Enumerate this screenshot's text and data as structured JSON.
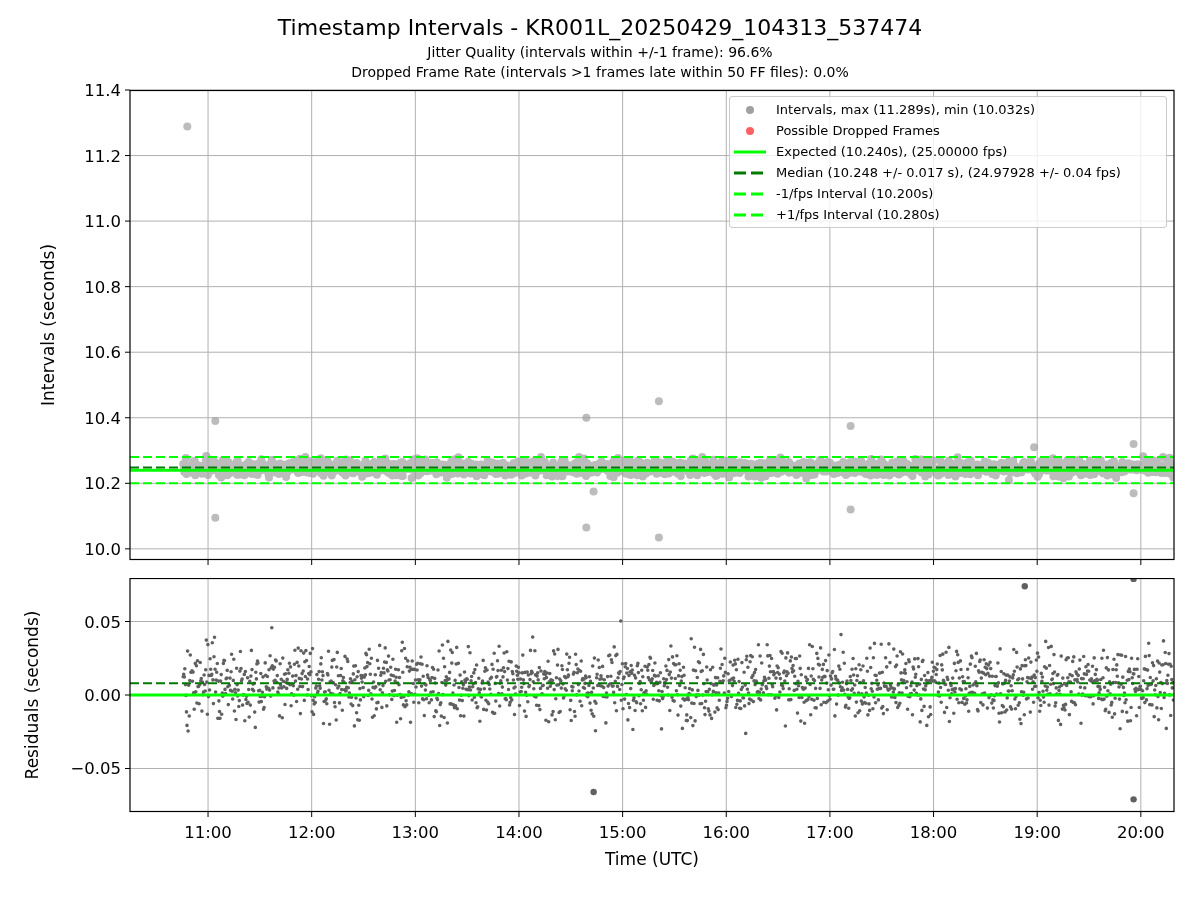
{
  "figure": {
    "title": "Timestamp Intervals - KR001L_20250429_104313_537474",
    "subtitles": [
      "Jitter Quality (intervals within +/-1 frame): 96.6%",
      "Dropped Frame Rate (intervals >1 frames late within 50 FF files): 0.0%"
    ]
  },
  "legend": [
    {
      "kind": "marker",
      "color": "#a0a0a0",
      "label": "Intervals, max (11.289s), min (10.032s)"
    },
    {
      "kind": "marker",
      "color": "#ff6060",
      "label": "Possible Dropped Frames"
    },
    {
      "kind": "solid",
      "color": "#00ff00",
      "label": "Expected (10.240s), (25.00000 fps)"
    },
    {
      "kind": "dashed",
      "color": "#007a00",
      "label": "Median (10.248 +/- 0.017 s), (24.97928 +/- 0.04 fps)"
    },
    {
      "kind": "dashed",
      "color": "#00ff00",
      "label": "-1/fps Interval (10.200s)"
    },
    {
      "kind": "dashed",
      "color": "#00ff00",
      "label": "+1/fps Interval (10.280s)"
    }
  ],
  "intervals_chart": {
    "chart_data": {
      "type": "scatter",
      "ylabel": "Intervals (seconds)",
      "grid": true,
      "xlim": [
        10.247,
        20.32
      ],
      "ylim": [
        9.966,
        11.4
      ],
      "yticks": [
        {
          "value": 10.0,
          "label": "10.0"
        },
        {
          "value": 10.2,
          "label": "10.2"
        },
        {
          "value": 10.4,
          "label": "10.4"
        },
        {
          "value": 10.6,
          "label": "10.6"
        },
        {
          "value": 10.8,
          "label": "10.8"
        },
        {
          "value": 11.0,
          "label": "11.0"
        },
        {
          "value": 11.2,
          "label": "11.2"
        },
        {
          "value": 11.4,
          "label": "11.4"
        }
      ],
      "x": [
        10.8,
        11.07,
        11.07,
        14.65,
        14.65,
        14.72,
        15.35,
        15.35,
        17.2,
        17.2,
        18.97,
        19.93,
        19.93
      ],
      "series": [
        {
          "color": "#a0a0a0",
          "values": [
            11.289,
            10.39,
            10.095,
            10.4,
            10.065,
            10.175,
            10.45,
            10.035,
            10.375,
            10.12,
            10.31,
            10.32,
            10.17
          ]
        }
      ],
      "ref_lines": [
        {
          "axis": "y",
          "value": 10.24
        },
        {
          "axis": "y",
          "value": 10.248
        },
        {
          "axis": "y",
          "value": 10.2
        },
        {
          "axis": "y",
          "value": 10.28
        }
      ]
    }
  },
  "residuals_chart": {
    "chart_data": {
      "type": "scatter",
      "ylabel": "Residuals (seconds)",
      "xlabel": "Time (UTC)",
      "grid": true,
      "xlim": [
        10.247,
        20.32
      ],
      "ylim": [
        -0.0796,
        0.0796
      ],
      "xticks": [
        {
          "value": 11,
          "label": "11:00"
        },
        {
          "value": 12,
          "label": "12:00"
        },
        {
          "value": 13,
          "label": "13:00"
        },
        {
          "value": 14,
          "label": "14:00"
        },
        {
          "value": 15,
          "label": "15:00"
        },
        {
          "value": 16,
          "label": "16:00"
        },
        {
          "value": 17,
          "label": "17:00"
        },
        {
          "value": 18,
          "label": "18:00"
        },
        {
          "value": 19,
          "label": "19:00"
        },
        {
          "value": 20,
          "label": "20:00"
        }
      ],
      "yticks": [
        {
          "value": -0.05,
          "label": "−0.05"
        },
        {
          "value": 0,
          "label": "0.00"
        },
        {
          "value": 0.05,
          "label": "0.05"
        }
      ],
      "x": [
        14.72,
        18.88,
        19.93,
        19.93
      ],
      "series": [
        {
          "color": "#606060",
          "values": [
            -0.066,
            0.074,
            0.079,
            -0.071
          ]
        }
      ],
      "ref_lines": [
        {
          "axis": "y",
          "value": 0
        },
        {
          "axis": "y",
          "value": 0.008
        }
      ]
    }
  }
}
